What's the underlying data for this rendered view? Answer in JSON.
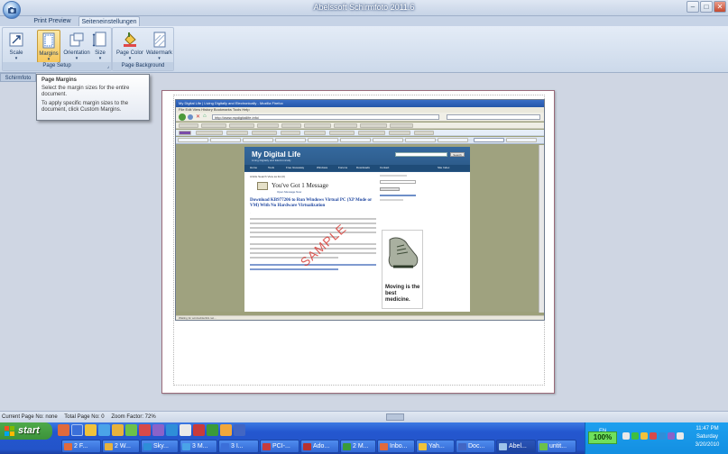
{
  "window": {
    "title": "Abelssoft Schirmfoto 2011.6"
  },
  "tabs": [
    {
      "label": "Print Preview"
    },
    {
      "label": "Seiteneinstellungen"
    }
  ],
  "ribbon": {
    "groups": [
      {
        "label": "Page Setup"
      },
      {
        "label": "Page Background"
      }
    ],
    "buttons": [
      {
        "label": "Scale",
        "icon": "scale-icon"
      },
      {
        "label": "Margins",
        "icon": "margins-icon"
      },
      {
        "label": "Orientation",
        "icon": "orientation-icon"
      },
      {
        "label": "Size",
        "icon": "size-icon"
      },
      {
        "label": "Page Color",
        "icon": "page-color-icon"
      },
      {
        "label": "Watermark",
        "icon": "watermark-icon"
      }
    ]
  },
  "left_tab": "Schirmfoto",
  "tooltip": {
    "title": "Page Margins",
    "line1": "Select the margin sizes for the entire document.",
    "line2": "To apply specific margin sizes to the document, click Custom Margins."
  },
  "preview": {
    "browser_title": "My Digital Life | Living Digitally and Electronically - Mozilla Firefox",
    "url": "http://www.mydigitallife.info/",
    "site_name": "My Digital Life",
    "site_tagline": "Living Digitally and Electronically",
    "search_button": "Search",
    "nav": [
      "Home",
      "Tools",
      "Free Giveaway",
      "Windows",
      "Forums",
      "Downloads",
      "Contact",
      "Site Index"
    ],
    "gmail_line": "Article Search   View as list (0)",
    "message_big": "You've Got 1 Message",
    "message_sub": "Open Message Now",
    "post_title": "Download KB977206 to Run Windows Virtual PC (XP Mode or VM) With No Hardware Virtualization",
    "watermark": "SAMPLE",
    "ad_text": "Moving is the best medicine.",
    "status": "Waiting for ad.doubleclick.net..."
  },
  "statusbar": {
    "current_page": "Current Page No: none",
    "total_page": "Total Page No: 0",
    "zoom": "Zoom Factor: 72%"
  },
  "taskbar": {
    "start_label": "start",
    "tasks": [
      {
        "label": "2 F..."
      },
      {
        "label": "2 W..."
      },
      {
        "label": "Sky..."
      },
      {
        "label": "3 M..."
      },
      {
        "label": "3 I..."
      },
      {
        "label": "PCI-..."
      },
      {
        "label": "Ado..."
      },
      {
        "label": "2 M..."
      },
      {
        "label": "Inbo..."
      },
      {
        "label": "Yah..."
      },
      {
        "label": "Doc..."
      },
      {
        "label": "Abel..."
      },
      {
        "label": "untit..."
      }
    ],
    "tray_zoom": "100%",
    "language": "EN",
    "time": "11:47 PM",
    "day": "Saturday",
    "date": "3/20/2010"
  },
  "colors": {
    "ribbon_bg": "#e4ecf7",
    "taskbar_blue": "#2354c9",
    "start_green": "#3b923a",
    "tray_zoom_green": "#6fe05c",
    "site_header": "#2a5785",
    "watermark_red": "#d8403a"
  }
}
